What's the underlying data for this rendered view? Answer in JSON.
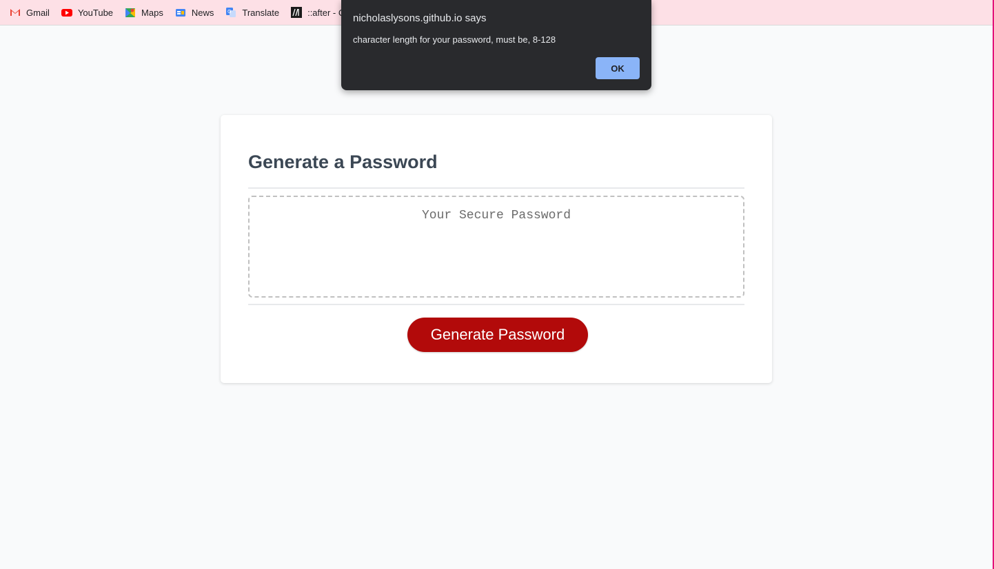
{
  "bookmarks": [
    {
      "label": "Gmail",
      "icon": "gmail-icon"
    },
    {
      "label": "YouTube",
      "icon": "youtube-icon"
    },
    {
      "label": "Maps",
      "icon": "maps-icon"
    },
    {
      "label": "News",
      "icon": "news-icon"
    },
    {
      "label": "Translate",
      "icon": "translate-icon"
    },
    {
      "label": "::after - CS",
      "icon": "mdn-icon"
    }
  ],
  "card": {
    "title": "Generate a Password",
    "password_placeholder": "Your Secure Password",
    "generate_label": "Generate Password"
  },
  "dialog": {
    "title": "nicholaslysons.github.io says",
    "message": "character length for your password, must be, 8-128",
    "ok_label": "OK"
  },
  "colors": {
    "bookmarks_bar": "#fde0e6",
    "button": "#b20a0a",
    "title": "#3b4754",
    "dialog_bg": "#292a2d",
    "dialog_ok": "#8ab4f8"
  }
}
